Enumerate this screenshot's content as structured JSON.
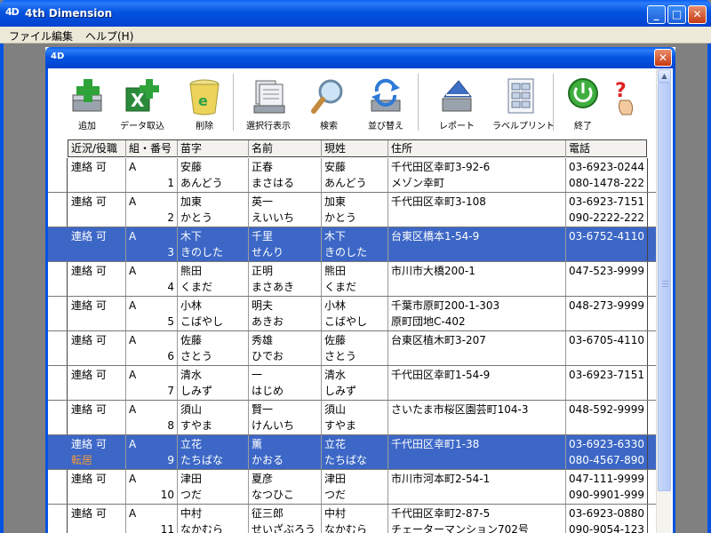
{
  "app": {
    "title": "4th Dimension",
    "logo": "4D",
    "colors": {
      "titlebar": "#0453e0",
      "selected_row": "#3c67c6",
      "memo_text": "#f39a3c"
    }
  },
  "window_controls": {
    "minimize": "_",
    "maximize": "□",
    "close": "✕"
  },
  "menu": [
    {
      "label": "ファイル"
    },
    {
      "label": "編集"
    },
    {
      "label": "ヘルプ(H)"
    }
  ],
  "inner_window": {
    "logo": "4D",
    "close": "✕"
  },
  "toolbar": [
    {
      "label": "追加",
      "icon": "add-record-icon"
    },
    {
      "label": "データ取込",
      "icon": "import-data-icon"
    },
    {
      "label": "削除",
      "icon": "delete-icon"
    },
    {
      "label": "選択行表示",
      "icon": "show-selection-icon"
    },
    {
      "label": "検索",
      "icon": "search-icon"
    },
    {
      "label": "並び替え",
      "icon": "sort-icon"
    },
    {
      "label": "レポート",
      "icon": "report-icon"
    },
    {
      "label": "ラベルプリント",
      "icon": "label-print-icon"
    },
    {
      "label": "終了",
      "icon": "quit-icon"
    },
    {
      "label": "",
      "icon": "help-icon"
    }
  ],
  "table": {
    "headers": [
      "近況/役職",
      "組・番号",
      "苗字",
      "名前",
      "現姓",
      "住所",
      "電話"
    ],
    "rows": [
      {
        "status": "連絡 可",
        "memo": "",
        "group": "A",
        "num": "1",
        "sei": "安藤",
        "sei_kana": "あんどう",
        "mei": "正春",
        "mei_kana": "まさはる",
        "gensei": "安藤",
        "gensei_kana": "あんどう",
        "addr1": "千代田区幸町3-92-6",
        "addr2": "メゾン幸町",
        "tel1": "03-6923-0244",
        "tel2": "080-1478-222",
        "selected": false
      },
      {
        "status": "連絡 可",
        "memo": "",
        "group": "A",
        "num": "2",
        "sei": "加東",
        "sei_kana": "かとう",
        "mei": "英一",
        "mei_kana": "えいいち",
        "gensei": "加東",
        "gensei_kana": "かとう",
        "addr1": "千代田区幸町3-108",
        "addr2": "",
        "tel1": "03-6923-7151",
        "tel2": "090-2222-222",
        "selected": false
      },
      {
        "status": "連絡 可",
        "memo": "",
        "group": "A",
        "num": "3",
        "sei": "木下",
        "sei_kana": "きのした",
        "mei": "千里",
        "mei_kana": "せんり",
        "gensei": "木下",
        "gensei_kana": "きのした",
        "addr1": "台東区橋本1-54-9",
        "addr2": "",
        "tel1": "03-6752-4110",
        "tel2": "",
        "selected": true
      },
      {
        "status": "連絡 可",
        "memo": "",
        "group": "A",
        "num": "4",
        "sei": "熊田",
        "sei_kana": "くまだ",
        "mei": "正明",
        "mei_kana": "まさあき",
        "gensei": "熊田",
        "gensei_kana": "くまだ",
        "addr1": "市川市大橋200-1",
        "addr2": "",
        "tel1": "047-523-9999",
        "tel2": "",
        "selected": false
      },
      {
        "status": "連絡 可",
        "memo": "",
        "group": "A",
        "num": "5",
        "sei": "小林",
        "sei_kana": "こばやし",
        "mei": "明夫",
        "mei_kana": "あきお",
        "gensei": "小林",
        "gensei_kana": "こばやし",
        "addr1": "千葉市原町200-1-303",
        "addr2": "原町団地C-402",
        "tel1": "048-273-9999",
        "tel2": "",
        "selected": false
      },
      {
        "status": "連絡 可",
        "memo": "",
        "group": "A",
        "num": "6",
        "sei": "佐藤",
        "sei_kana": "さとう",
        "mei": "秀雄",
        "mei_kana": "ひでお",
        "gensei": "佐藤",
        "gensei_kana": "さとう",
        "addr1": "台東区植木町3-207",
        "addr2": "",
        "tel1": "03-6705-4110",
        "tel2": "",
        "selected": false
      },
      {
        "status": "連絡 可",
        "memo": "",
        "group": "A",
        "num": "7",
        "sei": "清水",
        "sei_kana": "しみず",
        "mei": "一",
        "mei_kana": "はじめ",
        "gensei": "清水",
        "gensei_kana": "しみず",
        "addr1": "千代田区幸町1-54-9",
        "addr2": "",
        "tel1": "03-6923-7151",
        "tel2": "",
        "selected": false
      },
      {
        "status": "連絡 可",
        "memo": "",
        "group": "A",
        "num": "8",
        "sei": "須山",
        "sei_kana": "すやま",
        "mei": "賢一",
        "mei_kana": "けんいち",
        "gensei": "須山",
        "gensei_kana": "すやま",
        "addr1": "さいたま市桜区園芸町104-3",
        "addr2": "",
        "tel1": "048-592-9999",
        "tel2": "",
        "selected": false
      },
      {
        "status": "連絡 可",
        "memo": "転居",
        "group": "A",
        "num": "9",
        "sei": "立花",
        "sei_kana": "たちばな",
        "mei": "薫",
        "mei_kana": "かおる",
        "gensei": "立花",
        "gensei_kana": "たちばな",
        "addr1": "千代田区幸町1-38",
        "addr2": "",
        "tel1": "03-6923-6330",
        "tel2": "080-4567-890",
        "selected": true
      },
      {
        "status": "連絡 可",
        "memo": "",
        "group": "A",
        "num": "10",
        "sei": "津田",
        "sei_kana": "つだ",
        "mei": "夏彦",
        "mei_kana": "なつひこ",
        "gensei": "津田",
        "gensei_kana": "つだ",
        "addr1": "市川市河本町2-54-1",
        "addr2": "",
        "tel1": "047-111-9999",
        "tel2": "090-9901-999",
        "selected": false
      },
      {
        "status": "連絡 可",
        "memo": "",
        "group": "A",
        "num": "11",
        "sei": "中村",
        "sei_kana": "なかむら",
        "mei": "征三郎",
        "mei_kana": "せいざぶろう",
        "gensei": "中村",
        "gensei_kana": "なかむら",
        "addr1": "千代田区幸町2-87-5",
        "addr2": "チェーターマンション702号",
        "tel1": "03-6923-0880",
        "tel2": "090-9054-123",
        "selected": false
      }
    ]
  }
}
